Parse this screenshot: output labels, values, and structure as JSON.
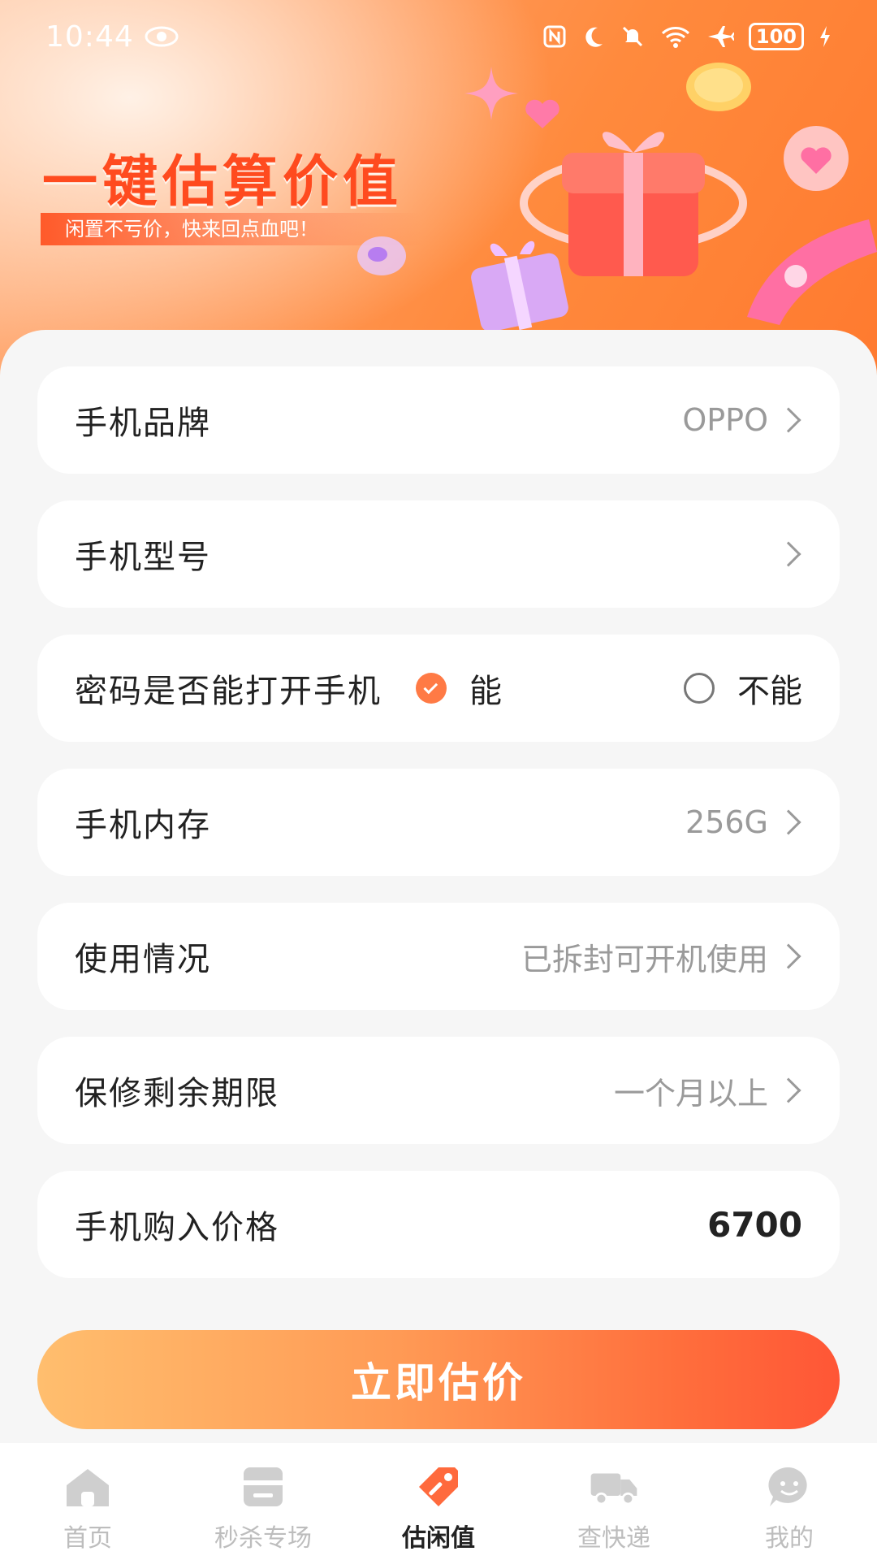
{
  "status_bar": {
    "time": "10:44",
    "battery": "100"
  },
  "hero": {
    "title": "一键估算价值",
    "subtitle": "闲置不亏价，快来回点血吧！"
  },
  "form": {
    "brand": {
      "label": "手机品牌",
      "value": "OPPO"
    },
    "model": {
      "label": "手机型号",
      "value": ""
    },
    "password": {
      "label": "密码是否能打开手机",
      "option_yes": "能",
      "option_no": "不能",
      "selected": "能"
    },
    "storage": {
      "label": "手机内存",
      "value": "256G"
    },
    "usage": {
      "label": "使用情况",
      "value": "已拆封可开机使用"
    },
    "warranty": {
      "label": "保修剩余期限",
      "value": "一个月以上"
    },
    "price": {
      "label": "手机购入价格",
      "value": "6700"
    }
  },
  "submit_label": "立即估价",
  "tabs": [
    {
      "label": "首页",
      "icon": "home-icon"
    },
    {
      "label": "秒杀专场",
      "icon": "flash-sale-icon"
    },
    {
      "label": "估闲值",
      "icon": "price-tag-icon",
      "active": true
    },
    {
      "label": "查快递",
      "icon": "truck-icon"
    },
    {
      "label": "我的",
      "icon": "profile-icon"
    }
  ],
  "colors": {
    "accent": "#ff7a45",
    "title": "#ff4b1f",
    "inactive_tab": "#bdbdbd"
  }
}
